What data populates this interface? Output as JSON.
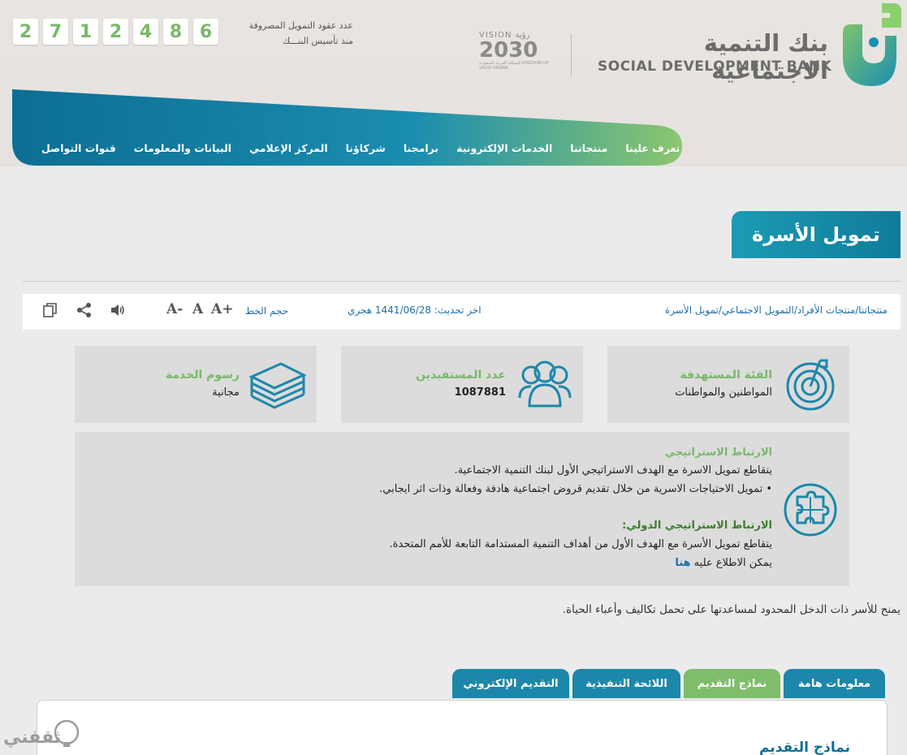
{
  "header": {
    "counter_digits": [
      "2",
      "7",
      "1",
      "2",
      "4",
      "8",
      "6"
    ],
    "counter_label_line1": "عدد عقود التمويل المصروفة",
    "counter_label_line2": "منذ تأسيس البنـــك",
    "vision_word": "VISION رؤية",
    "vision_year": "2030",
    "vision_kingdom": "المملكة العربية السعودية KINGDOM OF SAUDI ARABIA",
    "bank_name_ar": "بنك التنمية الاجتماعية",
    "bank_name_en": "SOCIAL DEVELOPMENT BANK"
  },
  "nav": {
    "items": [
      "تعرف علينا",
      "منتجاتنا",
      "الخدمات الإلكترونية",
      "برامجنا",
      "شركاؤنا",
      "المركز الإعلامي",
      "البيانات والمعلومات",
      "قنوات التواصل"
    ]
  },
  "page": {
    "title": "تمويل الأسرة"
  },
  "toolbar": {
    "breadcrumb": "منتجاتنا/منتجات الأفراد/التمويل الاجتماعي/تمويل الأسرة",
    "updated": "اخر تحديث: 1441/06/28 هجري",
    "font_size_label": "حجم الخط",
    "font_increase": "A+",
    "font_normal": "A",
    "font_decrease": "A-",
    "icons": [
      "speaker-icon",
      "share-icon",
      "copy-icon"
    ]
  },
  "cards": [
    {
      "title": "الفئة المستهدفة",
      "value": "المواطنين والمواطنات",
      "icon": "target-icon"
    },
    {
      "title": "عدد المستفيدين",
      "value": "1087881",
      "icon": "users-icon"
    },
    {
      "title": "رسوم الخدمة",
      "value": "مجانية",
      "icon": "money-stack-icon"
    }
  ],
  "strategy": {
    "heading": "الارتباط الاستراتيجي",
    "line1": "يتقاطع تمويل الاسرة مع الهدف الاستراتيجي الأول لبنك التنمية الاجتماعية.",
    "line2": "• تمويل الاحتياجات الاسرية من خلال تقديم قروض اجتماعية هادفة وفعالة وذات اثر ايجابي.",
    "intl_heading": "الارتباط الاستراتيجي الدولي:",
    "line3": "يتقاطع تمويل الأسرة مع الهدف الأول من أهداف التنمية المستدامة التابعة للأمم المتحدة.",
    "line4_prefix": "يمكن الاطلاع عليه ",
    "line4_link": "هنا",
    "icon": "puzzle-icon"
  },
  "description": "يمنح للأسر ذات الدخل المحدود لمساعدتها على تحمل تكاليف وأعباء الحياة.",
  "tabs": [
    {
      "label": "معلومات هامة",
      "color": "#1c87aa"
    },
    {
      "label": "نماذج التقديم",
      "color": "#7fbd6b"
    },
    {
      "label": "اللائحة التنفيذية",
      "color": "#1c87aa"
    },
    {
      "label": "التقديم الإلكتروني",
      "color": "#1c87aa"
    }
  ],
  "panel": {
    "heading": "نماذج التقديم"
  },
  "watermark": {
    "text": "ثقفني"
  },
  "colors": {
    "primary": "#1c87aa",
    "accent_green": "#7ab86a",
    "counter_green": "#7ab86a"
  }
}
